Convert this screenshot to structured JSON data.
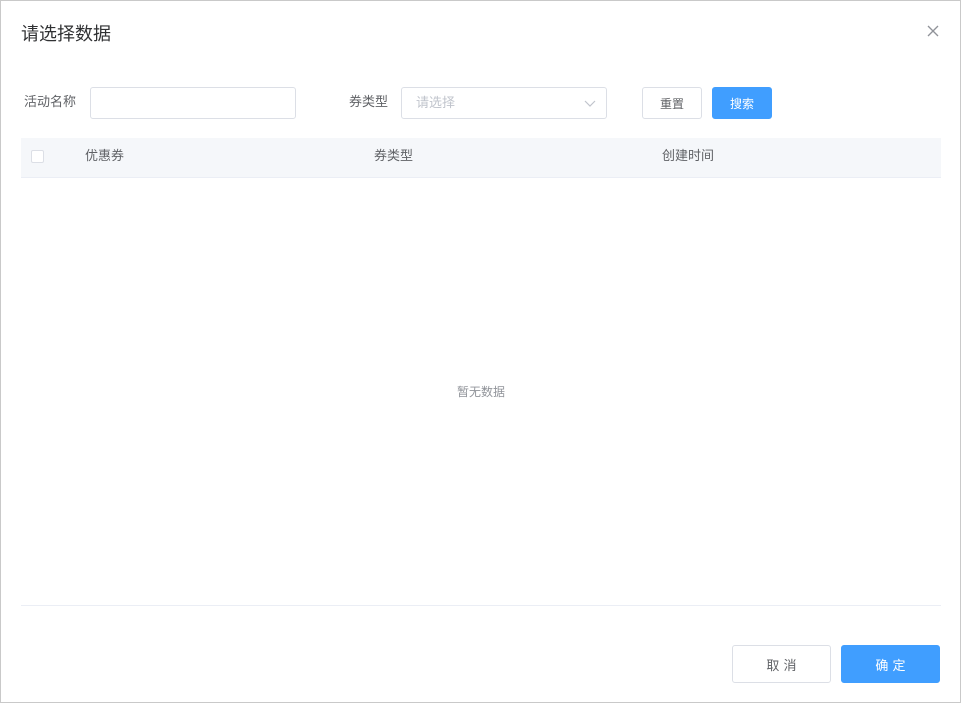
{
  "dialog": {
    "title": "请选择数据"
  },
  "filters": {
    "activity_name_label": "活动名称",
    "activity_name_value": "",
    "coupon_type_label": "券类型",
    "coupon_type_placeholder": "请选择",
    "reset_label": "重置",
    "search_label": "搜索"
  },
  "table": {
    "columns": [
      "优惠券",
      "券类型",
      "创建时间"
    ],
    "rows": [],
    "empty_text": "暂无数据"
  },
  "footer": {
    "cancel_label": "取 消",
    "confirm_label": "确 定"
  },
  "colors": {
    "primary": "#409eff",
    "border": "#dcdfe6",
    "header_bg": "#f5f7fa",
    "text": "#606266"
  }
}
